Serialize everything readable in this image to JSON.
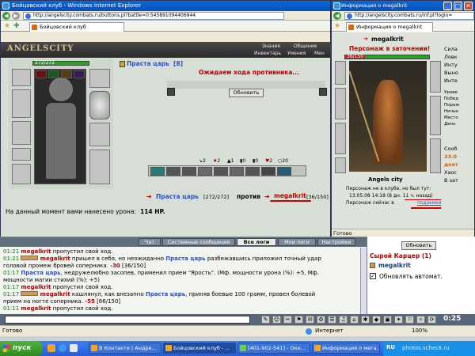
{
  "main_window": {
    "title": "Бойцовский клуб - Windows Internet Explorer",
    "url": "http://angelscity.combats.ru/buttons.pl?battle=0.545891094406944",
    "tab_label": "Бойцовский клуб"
  },
  "game_header": {
    "logo": "ANGELSCITY",
    "hp_value": "272/272",
    "menu": [
      "Знания",
      "Общение",
      "Инвентарь",
      "Умения",
      "Мен"
    ]
  },
  "player": {
    "name": "Праста царь",
    "level": "[8]",
    "hp": "[272/272]"
  },
  "opponent": {
    "name": "megalkrit",
    "hp": "[36/150]"
  },
  "battle": {
    "waiting_text": "Ожидаем хода противника...",
    "refresh_label": "Обновить",
    "versus_label": "против",
    "stats_row": [
      "2",
      "2",
      "1",
      "0",
      "0",
      "2",
      "20"
    ],
    "damage_label": "На данный момент вами нанесено урона:",
    "damage_value": "114 HP."
  },
  "chat_tabs": [
    "Чат",
    "Системные сообщения",
    "Все логи",
    "Мои логи",
    "Настройки"
  ],
  "log_lines": [
    {
      "time": "01:21",
      "name": "megalkrit",
      "text": "пропустил свой ход."
    },
    {
      "time": "01:21",
      "name": "megalkrit",
      "text_a": "пришел в себя, но неожиданно",
      "name2": "Праста царь",
      "text_b": "разбежавшись приложил точный удар"
    },
    {
      "text": "головой промеж бровей соперника.",
      "dmg": "-30",
      "tail": "[36/150]"
    },
    {
      "time": "01:17",
      "name": "Праста царь",
      "text": ", недружелюбно засопев, применил прием \"Ярость\". (Мф. мощности урона (%): +5, Мф."
    },
    {
      "text": "мощности магии стихий (%): +5)"
    },
    {
      "time": "01:17",
      "name": "megalkrit",
      "text": "пропустил свой ход."
    },
    {
      "time": "01:17",
      "name": "megalkrit",
      "text_a": "кашлянул, как внезапно",
      "name2": "Праста царь",
      "text_b": ", приняв боевые 100 грамм, провел болевой"
    },
    {
      "text": "прием на ногте соперника.",
      "dmg": "-55",
      "tail": "[66/150]"
    },
    {
      "time": "01:11",
      "name": "megalkrit",
      "text": "пропустил свой ход."
    }
  ],
  "chat_clock": "0:25",
  "status_bar": {
    "main": "Готово",
    "zone": "Интернет",
    "zoom": "100%"
  },
  "right_window": {
    "title": "Информация о megalkrit",
    "url": "http://angelscity.combats.ru/inf.pl?login=",
    "tab_label": "Информация о megalkrit",
    "nick": "megalkrit",
    "jail_text": "Персонаж в заточении!",
    "hp": "36/150",
    "city": "Angels city",
    "offline_line1": "Персонаж не в клубе, но был тут:",
    "offline_line2": "13.05.08 14:18 (8 дн. 11 ч. назад)",
    "location_prefix": "Персонаж сейчас в",
    "location": "подземке",
    "stats_labels": [
      "Сила",
      "Ловк",
      "Инту",
      "Выно",
      "Инте"
    ],
    "stats_labels2": [
      "Урове",
      "Побед",
      "Пораж",
      "Ничьи",
      "Место",
      "День"
    ],
    "side_text": [
      "Сооб",
      "23.0",
      "деят",
      "Хаос",
      "В зат"
    ],
    "status": "Готово"
  },
  "side_panel": {
    "refresh_label": "Обновить",
    "room_title": "Сырой Карцер (1)",
    "user_name": "megalkrit",
    "auto_refresh_label": "Обновлять автомат."
  },
  "taskbar": {
    "start": "пуск",
    "buttons": [
      "В Контакте | Андре...",
      "Бойцовский клуб - ...",
      "[401-902-541] - Окн...",
      "Информация о мега..."
    ],
    "lang": "RU",
    "watermark": "photos.scheck.ru"
  },
  "colors": {
    "title_blue": "#0a4fbd",
    "taskbar_blue": "#245edb",
    "start_green": "#3a9a2a",
    "accent_red": "#c00000",
    "link_blue": "#2a4fd0"
  }
}
